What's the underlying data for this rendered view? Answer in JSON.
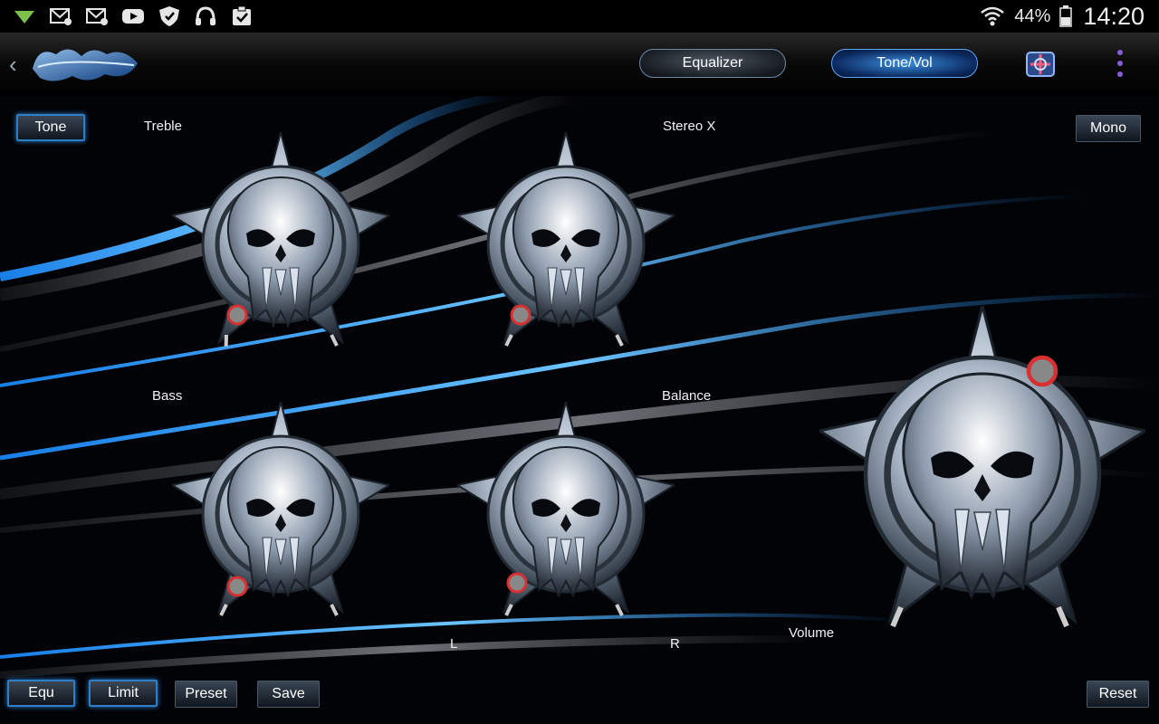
{
  "status_bar": {
    "icons": [
      "download-icon",
      "gmail-icon",
      "email-icon",
      "youtube-icon",
      "shield-icon",
      "headphones-icon",
      "clipboard-icon",
      "wifi-icon",
      "battery-icon"
    ],
    "battery_percent": "44%",
    "time": "14:20"
  },
  "action_bar": {
    "tabs": [
      {
        "label": "Equalizer",
        "active": false
      },
      {
        "label": "Tone/Vol",
        "active": true
      }
    ]
  },
  "controls": {
    "tone_button": "Tone",
    "mono_button": "Mono",
    "knobs": {
      "treble": "Treble",
      "stereo_x": "Stereo X",
      "bass": "Bass",
      "balance": "Balance",
      "volume": "Volume"
    },
    "balance_left": "L",
    "balance_right": "R"
  },
  "bottom_bar": {
    "equ": "Equ",
    "limit": "Limit",
    "preset": "Preset",
    "save": "Save",
    "reset": "Reset"
  },
  "colors": {
    "accent": "#2f7ec8",
    "background": "#000000",
    "knob_metal": "#b8c4d2",
    "indicator": "#d83030"
  }
}
